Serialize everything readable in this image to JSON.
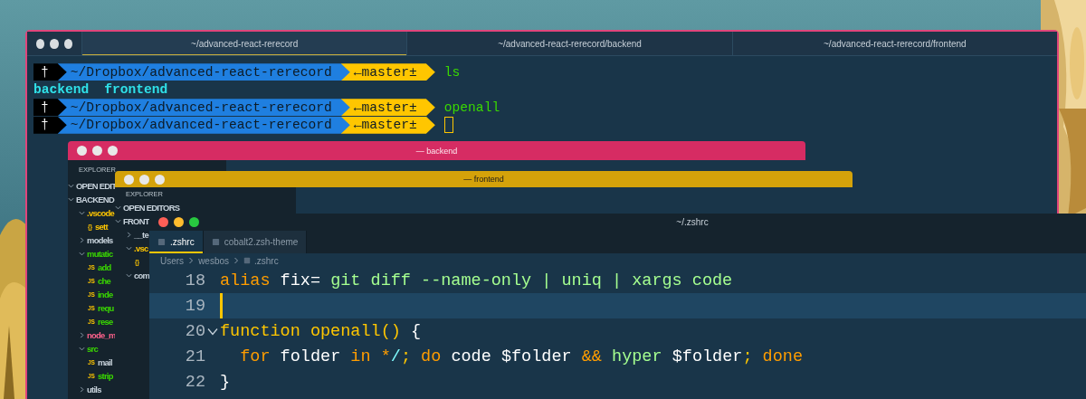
{
  "terminal": {
    "tabs": [
      {
        "label": "~/advanced-react-rerecord",
        "selected": true
      },
      {
        "label": "~/advanced-react-rerecord/backend",
        "selected": false
      },
      {
        "label": "~/advanced-react-rerecord/frontend",
        "selected": false
      }
    ],
    "lines": [
      {
        "kind": "prompt",
        "symbol": "†",
        "path": "~/Dropbox/advanced-react-rerecord",
        "branch": "←master±",
        "command": "ls",
        "cursor": false
      },
      {
        "kind": "output",
        "items": [
          "backend",
          "frontend"
        ]
      },
      {
        "kind": "prompt",
        "symbol": "†",
        "path": "~/Dropbox/advanced-react-rerecord",
        "branch": "←master±",
        "command": "openall",
        "cursor": false
      },
      {
        "kind": "prompt",
        "symbol": "†",
        "path": "~/Dropbox/advanced-react-rerecord",
        "branch": "←master±",
        "cursor": true
      }
    ]
  },
  "backend_window": {
    "title": "— backend",
    "sidebar_title": "EXPLORER",
    "tree": [
      {
        "kind": "section",
        "label": "OPEN EDIT",
        "expanded": true
      },
      {
        "kind": "section",
        "label": "BACKEND",
        "expanded": true,
        "children": [
          {
            "kind": "folder",
            "label": ".vscode",
            "color": "#ffc600",
            "expanded": true,
            "children": [
              {
                "kind": "file",
                "badge": "{}",
                "label": "sett",
                "color": "#ffc600"
              }
            ]
          },
          {
            "kind": "folder",
            "label": "models",
            "color": "#c8d3dc",
            "expanded": false
          },
          {
            "kind": "folder",
            "label": "mutatic",
            "color": "#3ad900",
            "expanded": true,
            "children": [
              {
                "kind": "file",
                "badge": "JS",
                "label": "add",
                "color": "#3ad900"
              },
              {
                "kind": "file",
                "badge": "JS",
                "label": "che",
                "color": "#3ad900"
              },
              {
                "kind": "file",
                "badge": "JS",
                "label": "inde",
                "color": "#3ad900"
              },
              {
                "kind": "file",
                "badge": "JS",
                "label": "requ",
                "color": "#3ad900"
              },
              {
                "kind": "file",
                "badge": "JS",
                "label": "rese",
                "color": "#3ad900"
              }
            ]
          },
          {
            "kind": "folder",
            "label": "node_m",
            "color": "#ff628c",
            "expanded": false
          },
          {
            "kind": "folder",
            "label": "src",
            "color": "#3ad900",
            "expanded": true,
            "children": [
              {
                "kind": "file",
                "badge": "JS",
                "label": "mail",
                "color": "#c8d3dc"
              },
              {
                "kind": "file",
                "badge": "JS",
                "label": "strip",
                "color": "#3ad900"
              }
            ]
          },
          {
            "kind": "folder",
            "label": "utils",
            "color": "#c8d3dc",
            "expanded": false
          }
        ]
      }
    ]
  },
  "frontend_window": {
    "title": "— frontend",
    "sidebar_title": "EXPLORER",
    "tree": [
      {
        "kind": "section",
        "label": "OPEN EDITORS",
        "expanded": true
      },
      {
        "kind": "section",
        "label": "FRONT",
        "expanded": true,
        "children": [
          {
            "kind": "folder",
            "label": "__te",
            "color": "#c8d3dc",
            "expanded": false
          },
          {
            "kind": "folder",
            "label": ".vsc",
            "color": "#ffc600",
            "expanded": true,
            "children": [
              {
                "kind": "file",
                "badge": "{}"
              }
            ]
          },
          {
            "kind": "folder",
            "label": "com",
            "color": "#c8d3dc",
            "expanded": true
          }
        ]
      }
    ]
  },
  "editor_window": {
    "title": "~/.zshrc",
    "tabs": [
      {
        "label": ".zshrc",
        "selected": true
      },
      {
        "label": "cobalt2.zsh-theme",
        "selected": false
      }
    ],
    "breadcrumb": [
      "Users",
      "wesbos",
      ".zshrc"
    ],
    "lines": [
      {
        "number": "18",
        "current": false,
        "fold": false,
        "tokens": [
          {
            "kind": "keyword",
            "text": "alias"
          },
          {
            "kind": "plain",
            "text": " fix= "
          },
          {
            "kind": "string",
            "text": "git diff --name-only | uniq | xargs code"
          }
        ]
      },
      {
        "number": "19",
        "current": true,
        "fold": false
      },
      {
        "number": "20",
        "current": false,
        "fold": true,
        "tokens": [
          {
            "kind": "func",
            "text": "function openall() "
          },
          {
            "kind": "plain",
            "text": "{"
          }
        ]
      },
      {
        "number": "21",
        "current": false,
        "fold": false,
        "tokens": [
          {
            "kind": "keyword",
            "text": "  for"
          },
          {
            "kind": "plain",
            "text": " folder "
          },
          {
            "kind": "keyword",
            "text": "in *"
          },
          {
            "kind": "path",
            "text": "/"
          },
          {
            "kind": "func",
            "text": ";"
          },
          {
            "kind": "keyword",
            "text": " do"
          },
          {
            "kind": "plain",
            "text": " code $folder "
          },
          {
            "kind": "keyword",
            "text": "&&"
          },
          {
            "kind": "string",
            "text": " hyper"
          },
          {
            "kind": "plain",
            "text": " $folder"
          },
          {
            "kind": "func",
            "text": ";"
          },
          {
            "kind": "keyword",
            "text": " done"
          }
        ]
      },
      {
        "number": "22",
        "current": false,
        "fold": false,
        "tokens": [
          {
            "kind": "plain",
            "text": "}"
          }
        ]
      }
    ]
  }
}
